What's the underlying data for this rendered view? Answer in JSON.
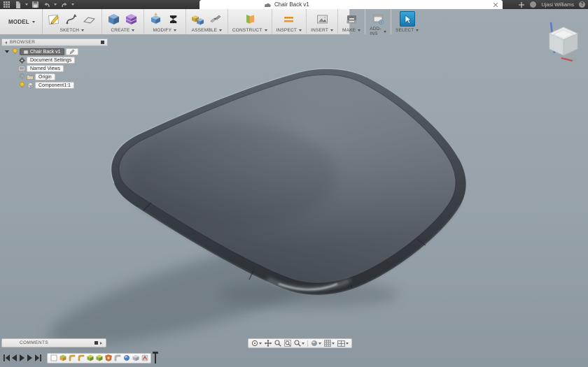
{
  "titlebar": {
    "tab_title": "Chair Back v1",
    "username": "Ujasi Williams",
    "help_label": "?",
    "left_icons": [
      "apps-grid",
      "file-menu",
      "save",
      "undo",
      "redo"
    ],
    "right_icons": [
      "close-tab",
      "new-tab",
      "notifications",
      "help"
    ]
  },
  "toolbar": {
    "workspace": "MODEL",
    "groups": [
      {
        "label": "SKETCH",
        "icons": [
          "create-sketch",
          "spline",
          "sketch-rectangle"
        ]
      },
      {
        "label": "CREATE",
        "icons": [
          "extrude",
          "press-pull-box"
        ]
      },
      {
        "label": "MODIFY",
        "icons": [
          "press-pull",
          "change-parameters-sigma"
        ]
      },
      {
        "label": "ASSEMBLE",
        "icons": [
          "new-component",
          "joint"
        ]
      },
      {
        "label": "CONSTRUCT",
        "icons": [
          "construction-plane"
        ]
      },
      {
        "label": "INSPECT",
        "icons": [
          "measure"
        ]
      },
      {
        "label": "INSERT",
        "icons": [
          "insert-image"
        ]
      },
      {
        "label": "MAKE",
        "icons": [
          "3d-print"
        ]
      },
      {
        "label": "ADD-INS",
        "icons": [
          "scripts-addins"
        ]
      },
      {
        "label": "SELECT",
        "icons": [
          "select-cursor"
        ]
      }
    ]
  },
  "browser": {
    "header": "BROWSER",
    "items": [
      {
        "label": "Chair Back v1",
        "selected": true,
        "icons": [
          "expander",
          "visibility-bulb",
          "document",
          "edit-pencil"
        ]
      },
      {
        "label": "Document Settings",
        "selected": false,
        "icons": [
          "gear"
        ]
      },
      {
        "label": "Named Views",
        "selected": false,
        "icons": [
          "named-views"
        ]
      },
      {
        "label": "Origin",
        "selected": false,
        "icons": [
          "visibility-bulb",
          "folder"
        ]
      },
      {
        "label": "Component1:1",
        "selected": false,
        "icons": [
          "visibility-bulb",
          "component-box"
        ]
      }
    ]
  },
  "comments": {
    "label": "COMMENTS"
  },
  "nav_toolbar": {
    "icons": [
      "orbit",
      "pan",
      "zoom",
      "fit",
      "zoom-window",
      "display-settings",
      "grid-layout",
      "viewports"
    ]
  },
  "timeline": {
    "playback_icons": [
      "go-to-start",
      "step-back",
      "play",
      "step-forward",
      "go-to-end"
    ],
    "features": [
      "sketch",
      "form",
      "fillet",
      "fillet",
      "extrude",
      "extrude",
      "boundary-fill",
      "fillet",
      "revolve",
      "shell",
      "appearance"
    ]
  },
  "viewcube": {
    "axis_colors": {
      "z": "#5a79c4",
      "x": "#c0504d"
    }
  },
  "colors": {
    "accent_blue": "#1f9bd6",
    "canvas_top": "#9fa9b0",
    "canvas_bottom": "#8c97a0",
    "selection_gray": "#6d6d6d",
    "bulb_yellow": "#e9b115",
    "titlebar": "#3c3c3c"
  }
}
